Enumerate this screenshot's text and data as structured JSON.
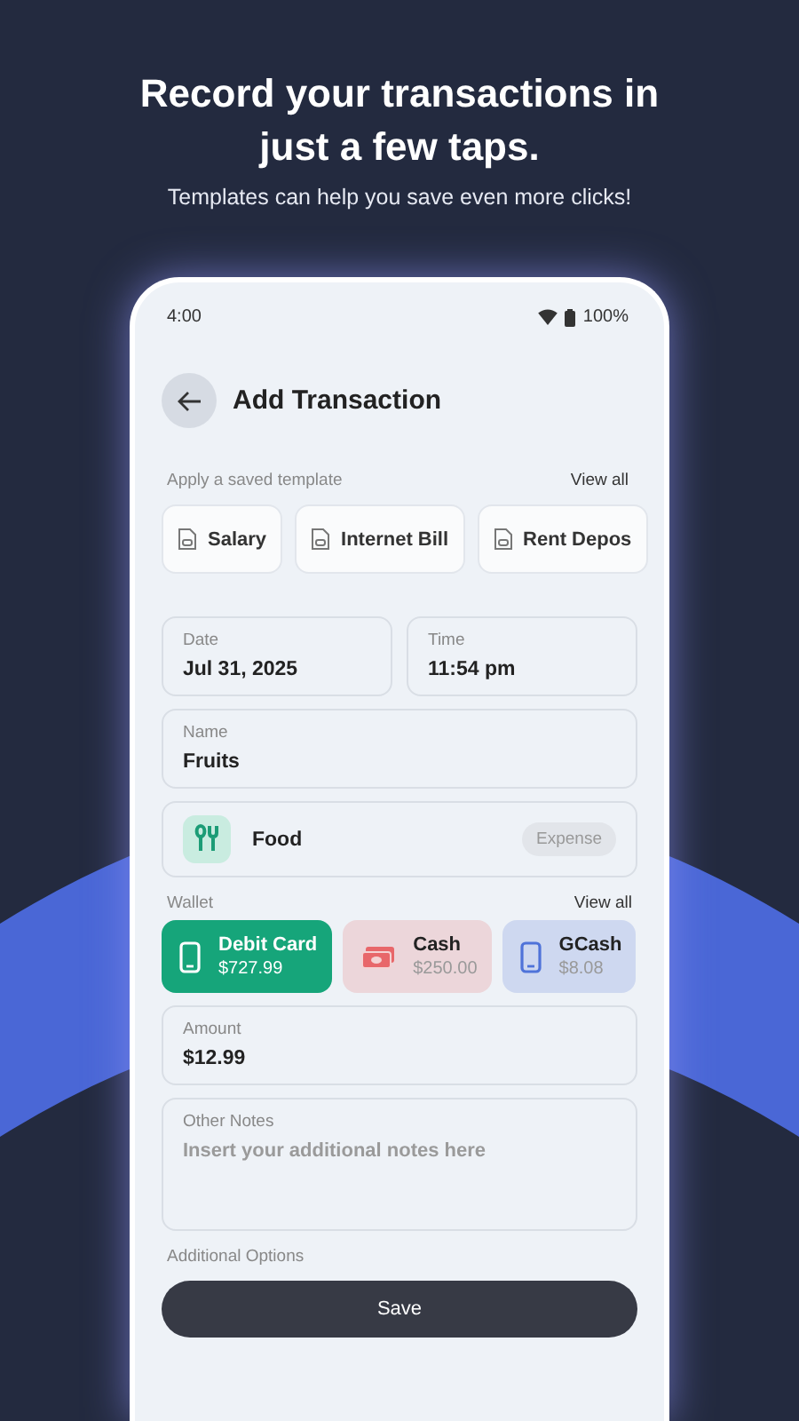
{
  "headline": "Record your transactions in just a few taps.",
  "subtitle": "Templates can help you save even more clicks!",
  "status_bar": {
    "time": "4:00",
    "battery": "100%"
  },
  "screen_title": "Add Transaction",
  "templates": {
    "label": "Apply a saved template",
    "view_all": "View all",
    "items": [
      "Salary",
      "Internet Bill",
      "Rent Depos"
    ]
  },
  "date": {
    "label": "Date",
    "value": "Jul 31, 2025"
  },
  "time": {
    "label": "Time",
    "value": "11:54 pm"
  },
  "name": {
    "label": "Name",
    "value": "Fruits"
  },
  "category": {
    "name": "Food",
    "type": "Expense"
  },
  "wallet": {
    "label": "Wallet",
    "view_all": "View all",
    "items": [
      {
        "kind": "card",
        "name": "Debit Card",
        "balance": "$727.99",
        "color": "#16a57a",
        "selected": true
      },
      {
        "kind": "cash",
        "name": "Cash",
        "balance": "$250.00",
        "color": "#e8676a",
        "selected": false
      },
      {
        "kind": "phone",
        "name": "GCash",
        "balance": "$8.08",
        "color": "#4f73d9",
        "selected": false
      }
    ]
  },
  "amount": {
    "label": "Amount",
    "value": "$12.99"
  },
  "notes": {
    "label": "Other Notes",
    "placeholder": "Insert your additional notes here"
  },
  "additional_options": "Additional Options",
  "save": "Save"
}
